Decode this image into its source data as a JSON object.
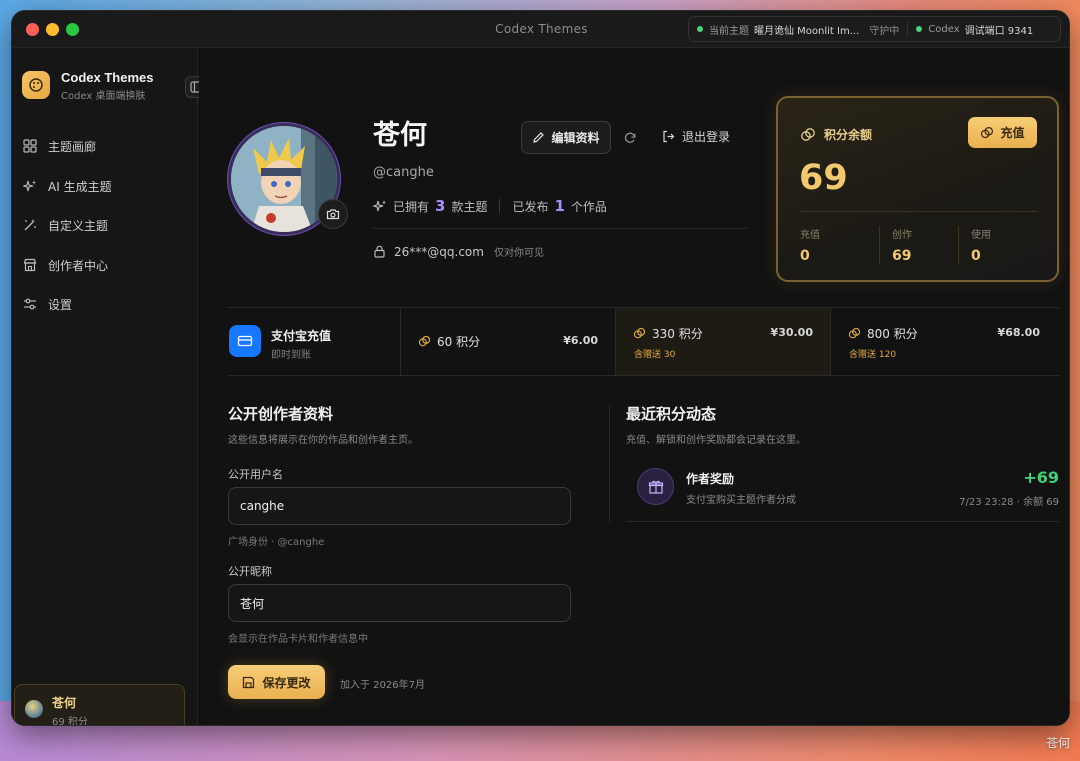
{
  "window": {
    "title": "Codex Themes",
    "status": {
      "theme_label": "当前主题",
      "theme_name": "曜月诡仙 Moonlit Im...",
      "guard": "守护中",
      "codex_label": "Codex",
      "port": "调试端口 9341"
    }
  },
  "sidebar": {
    "brand_title": "Codex Themes",
    "brand_sub": "Codex 桌面端换肤",
    "items": [
      {
        "label": "主题画廊",
        "icon": "grid-icon"
      },
      {
        "label": "AI 生成主题",
        "icon": "sparkles-icon"
      },
      {
        "label": "自定义主题",
        "icon": "wand-icon"
      },
      {
        "label": "创作者中心",
        "icon": "store-icon"
      },
      {
        "label": "设置",
        "icon": "sliders-icon"
      }
    ],
    "user": {
      "name": "苍何",
      "points": "69 积分"
    }
  },
  "profile": {
    "name": "苍何",
    "handle": "@canghe",
    "owned_label": "已拥有",
    "owned_count": "3",
    "owned_unit": "款主题",
    "published_label": "已发布",
    "published_count": "1",
    "published_unit": "个作品",
    "email": "26***@qq.com",
    "email_hint": "仅对你可见",
    "edit_label": "编辑资料",
    "logout_label": "退出登录"
  },
  "balance": {
    "title": "积分余额",
    "recharge_label": "充值",
    "value": "69",
    "cols": [
      {
        "label": "充值",
        "value": "0"
      },
      {
        "label": "创作",
        "value": "69"
      },
      {
        "label": "使用",
        "value": "0"
      }
    ]
  },
  "packs": {
    "pay_title": "支付宝充值",
    "pay_sub": "即时到账",
    "items": [
      {
        "amount": "60 积分",
        "price": "¥6.00",
        "bonus": ""
      },
      {
        "amount": "330 积分",
        "price": "¥30.00",
        "bonus": "含赠送 30"
      },
      {
        "amount": "800 积分",
        "price": "¥68.00",
        "bonus": "含赠送 120"
      }
    ]
  },
  "creator_profile": {
    "title": "公开创作者资料",
    "subtitle": "这些信息将展示在你的作品和创作者主页。",
    "username_label": "公开用户名",
    "username_value": "canghe",
    "username_hint": "广场身份 · @canghe",
    "nickname_label": "公开昵称",
    "nickname_value": "苍何",
    "nickname_hint": "会显示在作品卡片和作者信息中",
    "save_label": "保存更改",
    "joined": "加入于 2026年7月"
  },
  "activity": {
    "title": "最近积分动态",
    "subtitle": "充值、解锁和创作奖励都会记录在这里。",
    "items": [
      {
        "title": "作者奖励",
        "sub": "支付宝购买主题作者分成",
        "amount": "+69",
        "meta": "7/23 23:28 · 余额 69"
      }
    ]
  },
  "watermark": "苍何"
}
